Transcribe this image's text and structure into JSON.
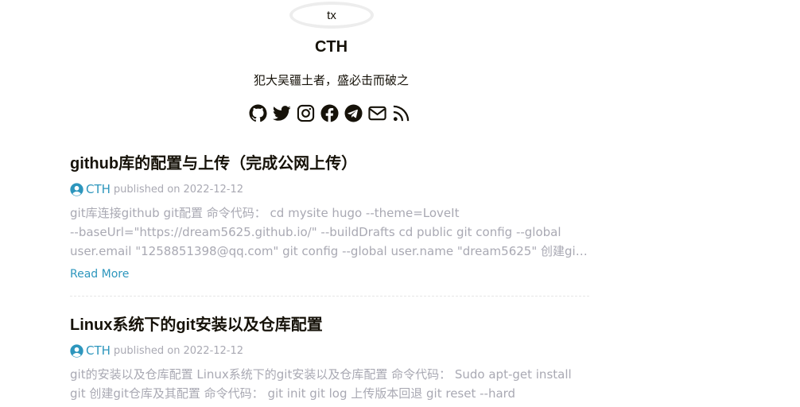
{
  "profile": {
    "avatar_alt": "tx",
    "name": "CTH",
    "subtitle": "犯大吴疆土者，盛必击而破之",
    "social_icons": [
      "github-icon",
      "twitter-icon",
      "instagram-icon",
      "facebook-icon",
      "telegram-icon",
      "email-icon",
      "rss-icon"
    ]
  },
  "posts": [
    {
      "title": "github库的配置与上传（完成公网上传）",
      "author": "CTH",
      "published_label": "published on",
      "date": "2022-12-12",
      "summary_lines": [
        "git库连接github git配置 命令代码： cd mysite hugo --theme=LoveIt",
        "--baseUrl=\"https://dream5625.github.io/\" --buildDrafts cd public git config --global",
        "user.email \"1258851398@qq.com\" git config --global user.name \"dream5625\" 创建git仓…"
      ],
      "read_more": "Read More"
    },
    {
      "title": "Linux系统下的git安装以及仓库配置",
      "author": "CTH",
      "published_label": "published on",
      "date": "2022-12-12",
      "summary_lines": [
        "git的安装以及仓库配置 Linux系统下的git安装以及仓库配置 命令代码： Sudo apt-get install",
        "git 创建git仓库及其配置 命令代码： git init git log 上传版本回退 git reset --hard"
      ]
    }
  ],
  "colors": {
    "text": "#161209",
    "muted": "#a9a9b3",
    "link": "#2d96bd"
  }
}
